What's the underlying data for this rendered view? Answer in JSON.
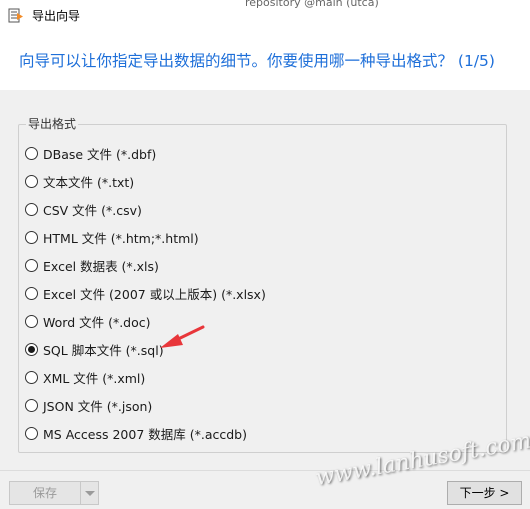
{
  "window": {
    "title": "导出向导",
    "background_tab_text": "repository @main (utca)",
    "background_close": "×"
  },
  "heading": "向导可以让你指定导出数据的细节。你要使用哪一种导出格式？ (1/5)",
  "group": {
    "legend": "导出格式",
    "options": [
      {
        "label": "DBase 文件 (*.dbf)",
        "checked": false
      },
      {
        "label": "文本文件 (*.txt)",
        "checked": false
      },
      {
        "label": "CSV 文件 (*.csv)",
        "checked": false
      },
      {
        "label": "HTML 文件 (*.htm;*.html)",
        "checked": false
      },
      {
        "label": "Excel 数据表 (*.xls)",
        "checked": false
      },
      {
        "label": "Excel 文件 (2007 或以上版本) (*.xlsx)",
        "checked": false
      },
      {
        "label": "Word 文件 (*.doc)",
        "checked": false
      },
      {
        "label": "SQL 脚本文件 (*.sql)",
        "checked": true
      },
      {
        "label": "XML 文件 (*.xml)",
        "checked": false
      },
      {
        "label": "JSON 文件 (*.json)",
        "checked": false
      },
      {
        "label": "MS Access 2007 数据库 (*.accdb)",
        "checked": false
      }
    ]
  },
  "footer": {
    "save_label": "保存",
    "next_label": "下一步 >"
  },
  "watermark": "www.lanhusoft.com",
  "colors": {
    "heading": "#1e6fd9",
    "arrow": "#e8363a",
    "title_icon_accent": "#f28c28"
  }
}
